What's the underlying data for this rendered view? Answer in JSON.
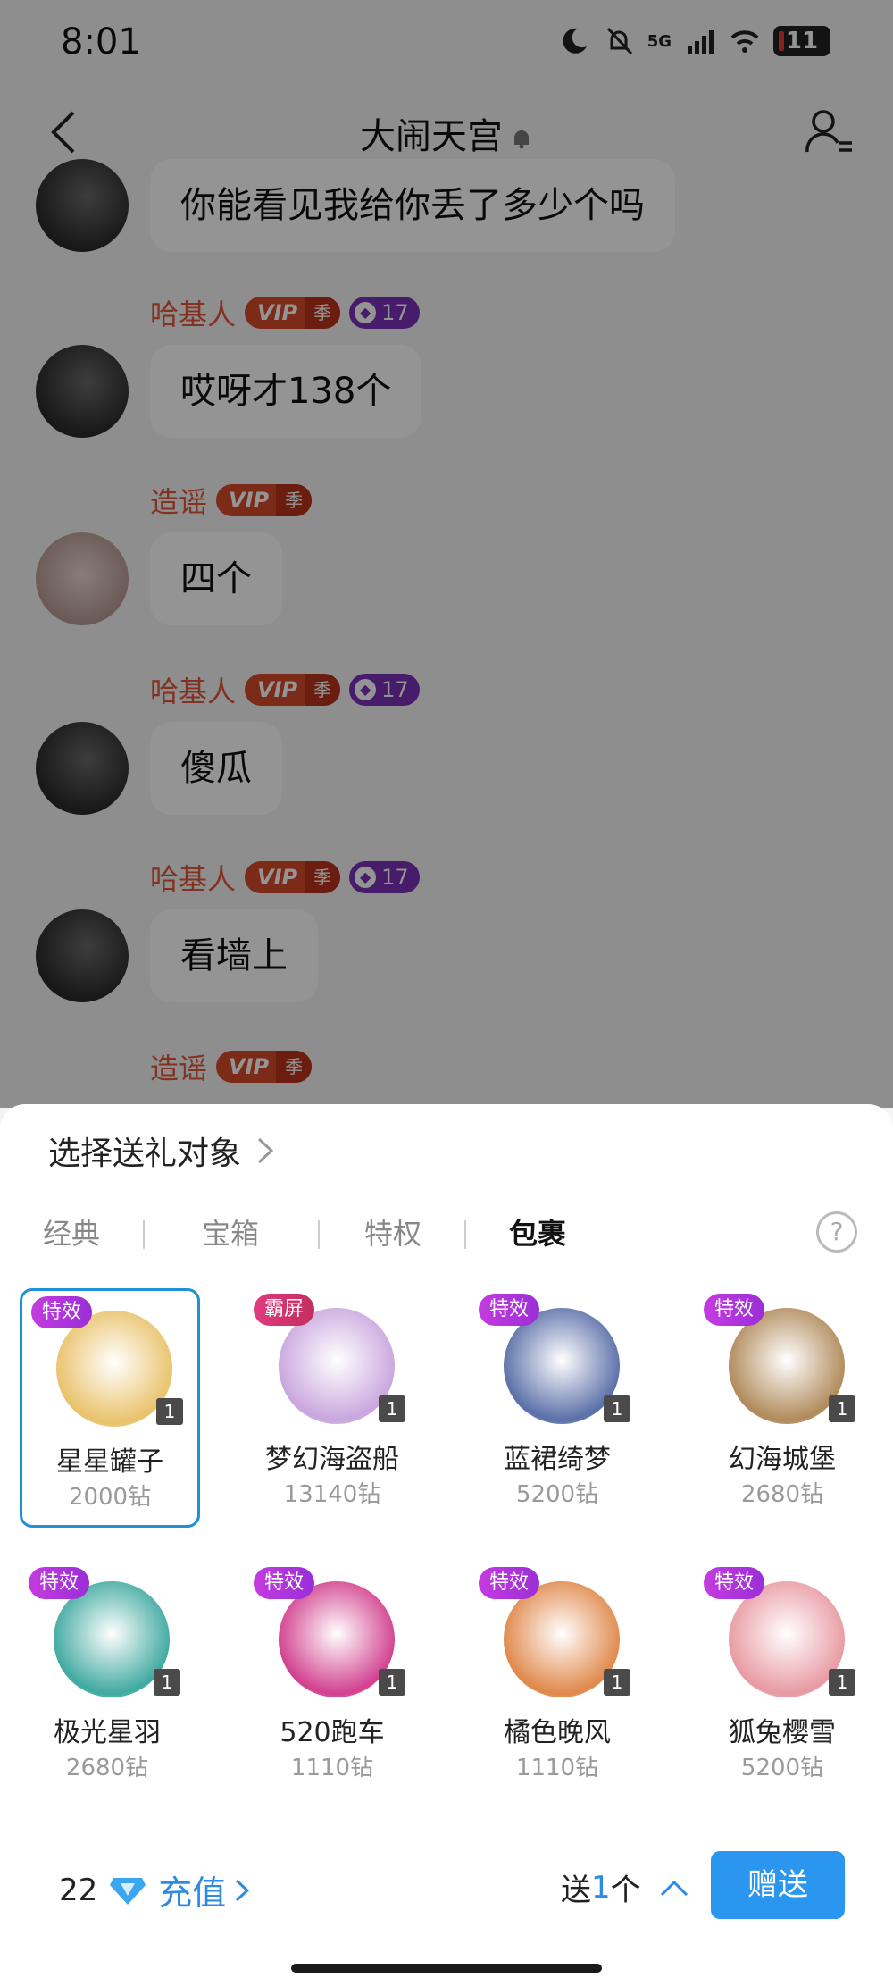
{
  "status_bar": {
    "time": "8:01",
    "battery": "11",
    "network": "5G"
  },
  "header": {
    "title": "大闹天宫"
  },
  "messages": [
    {
      "text": "你能看见我给你丢了多少个吗"
    },
    {
      "sender": "哈基人",
      "vip": "VIP",
      "season": "季",
      "level": "17",
      "text": "哎呀才138个"
    },
    {
      "sender": "造谣",
      "vip": "VIP",
      "season": "季",
      "text": "四个"
    },
    {
      "sender": "哈基人",
      "vip": "VIP",
      "season": "季",
      "level": "17",
      "text": "傻瓜"
    },
    {
      "sender": "哈基人",
      "vip": "VIP",
      "season": "季",
      "level": "17",
      "text": "看墙上"
    },
    {
      "sender": "造谣",
      "vip": "VIP",
      "season": "季"
    }
  ],
  "gift_panel": {
    "recipient_label": "选择送礼对象",
    "tabs": [
      "经典",
      "宝箱",
      "特权",
      "包裹"
    ],
    "active_tab": "包裹",
    "help": "?",
    "gifts": [
      {
        "tag": "特效",
        "name": "星星罐子",
        "price": "2000钻",
        "count": "1",
        "color": "#e9c26a"
      },
      {
        "tag": "霸屏",
        "name": "梦幻海盗船",
        "price": "13140钻",
        "count": "1",
        "color": "#c9a6de"
      },
      {
        "tag": "特效",
        "name": "蓝裙绮梦",
        "price": "5200钻",
        "count": "1",
        "color": "#5a6fa8"
      },
      {
        "tag": "特效",
        "name": "幻海城堡",
        "price": "2680钻",
        "count": "1",
        "color": "#b08a5a"
      },
      {
        "tag": "特效",
        "name": "极光星羽",
        "price": "2680钻",
        "count": "1",
        "color": "#3fa9a0"
      },
      {
        "tag": "特效",
        "name": "520跑车",
        "price": "1110钻",
        "count": "1",
        "color": "#d1408e"
      },
      {
        "tag": "特效",
        "name": "橘色晚风",
        "price": "1110钻",
        "count": "1",
        "color": "#e0884a"
      },
      {
        "tag": "特效",
        "name": "狐兔樱雪",
        "price": "5200钻",
        "count": "1",
        "color": "#e89aa2"
      }
    ],
    "balance": "22",
    "recharge_label": "充值",
    "send_prefix": "送",
    "send_count": "1",
    "send_suffix": "个",
    "send_button": "赠送"
  }
}
